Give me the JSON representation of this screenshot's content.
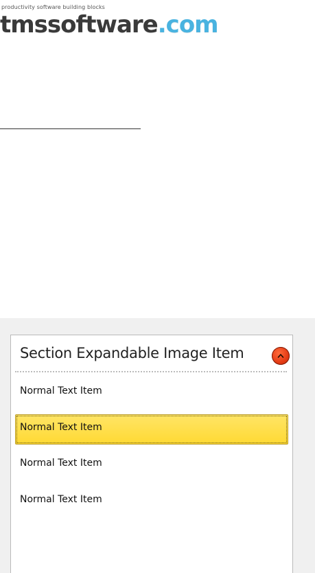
{
  "logo": {
    "tagline": "productivity software building blocks",
    "name": "tmssoftware",
    "tld": ".com"
  },
  "list": {
    "section": {
      "title": "Section Expandable Image Item",
      "button_icon": "chevron-up-icon",
      "button_color": "#e33a14"
    },
    "items": [
      {
        "label": "Normal Text Item",
        "selected": false
      },
      {
        "label": "Normal Text Item",
        "selected": true
      },
      {
        "label": "Normal Text Item",
        "selected": false
      },
      {
        "label": "Normal Text Item",
        "selected": false
      }
    ],
    "selected_color": "#ffdf4a"
  }
}
